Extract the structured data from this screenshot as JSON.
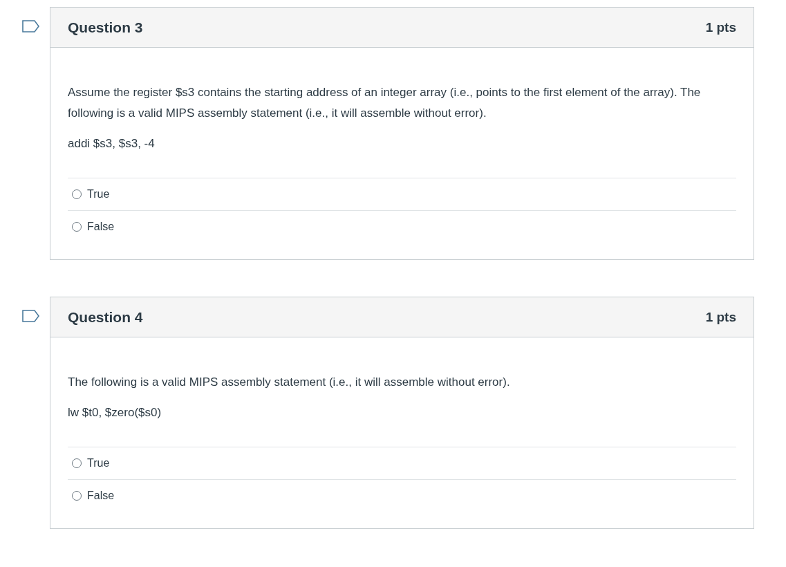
{
  "questions": [
    {
      "flagged": false,
      "title": "Question 3",
      "points": "1 pts",
      "paragraphs": [
        "Assume the register $s3 contains the starting address of an integer array (i.e., points to the first element of the array). The following is a valid MIPS assembly statement (i.e., it will assemble without error).",
        "addi $s3, $s3, -4"
      ],
      "answers": [
        {
          "label": "True",
          "selected": false
        },
        {
          "label": "False",
          "selected": false
        }
      ]
    },
    {
      "flagged": false,
      "title": "Question 4",
      "points": "1 pts",
      "paragraphs": [
        "The following is a valid MIPS assembly statement (i.e., it will assemble without error).",
        "lw $t0, $zero($s0)"
      ],
      "answers": [
        {
          "label": "True",
          "selected": false
        },
        {
          "label": "False",
          "selected": false
        }
      ]
    }
  ]
}
